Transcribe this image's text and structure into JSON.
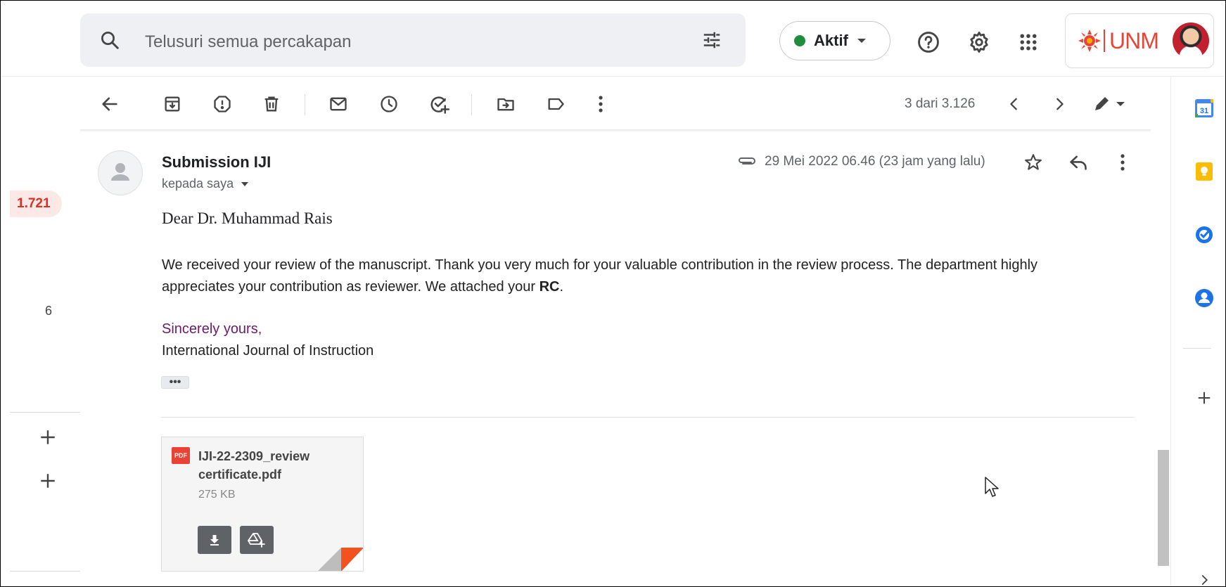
{
  "search": {
    "placeholder": "Telusuri semua percakapan"
  },
  "status": {
    "label": "Aktif",
    "color": "#1e8e3e"
  },
  "account": {
    "org_label": "UNM"
  },
  "toolbar": {
    "page_count": "3 dari 3.126"
  },
  "left_rail": {
    "unread_badge": "1.721",
    "folder_count": "6"
  },
  "message": {
    "sender": "Submission IJI",
    "recipient": "kepada saya",
    "date": "29 Mei 2022 06.46 (23 jam yang lalu)",
    "greeting": "Dear Dr. Muhammad Rais",
    "paragraph_start": "We received your review of the manuscript. Thank you very much for your valuable contribution in the review process. The department highly appreciates your contribution as reviewer. We attached your ",
    "paragraph_bold": "RC",
    "paragraph_end": ".",
    "sign_line1": "Sincerely yours,",
    "sign_line2": "International Journal of Instruction",
    "trimmed_label": "•••"
  },
  "attachment": {
    "type_badge": "PDF",
    "filename": "IJI-22-2309_review certificate.pdf",
    "size": "275 KB"
  },
  "side_panel": {
    "calendar_day": "31"
  },
  "colors": {
    "accent_red": "#ea4335",
    "badge_bg": "#fce8e6",
    "signature_purple": "#6a1b6a",
    "keep_yellow": "#fbbc04",
    "tasks_blue": "#1a73e8"
  }
}
